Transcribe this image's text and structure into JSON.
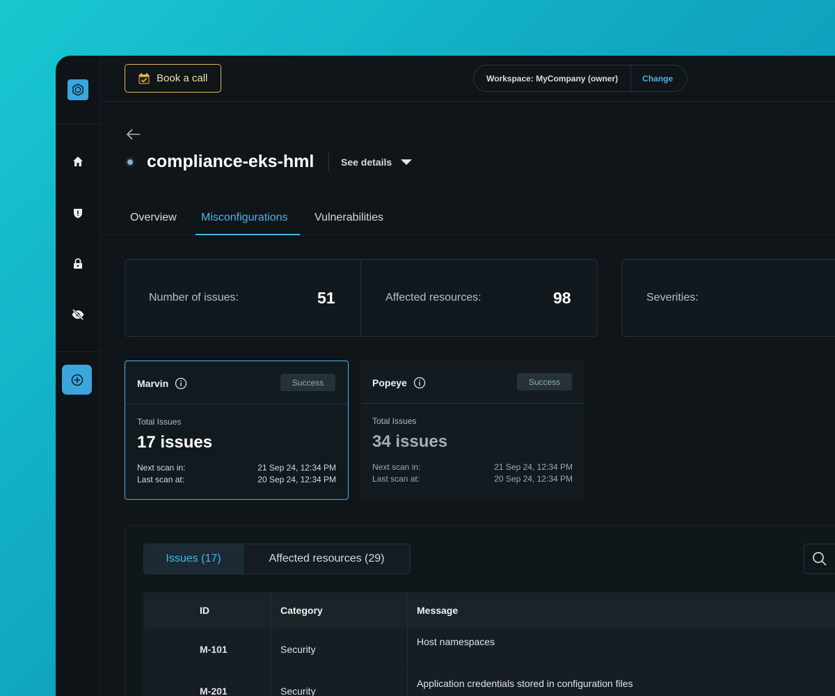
{
  "topbar": {
    "book_call_label": "Book a call",
    "workspace_label": "Workspace: MyCompany (owner)",
    "workspace_change": "Change"
  },
  "header": {
    "title": "compliance-eks-hml",
    "see_details": "See details"
  },
  "tabs": [
    {
      "label": "Overview",
      "active": false
    },
    {
      "label": "Misconfigurations",
      "active": true
    },
    {
      "label": "Vulnerabilities",
      "active": false
    }
  ],
  "stats": {
    "issues_label": "Number of issues:",
    "issues_value": "51",
    "resources_label": "Affected resources:",
    "resources_value": "98",
    "severities_label": "Severities:"
  },
  "scanners": [
    {
      "name": "Marvin",
      "status": "Success",
      "total_label": "Total Issues",
      "total_value": "17 issues",
      "next_label": "Next scan in:",
      "next_value": "21 Sep 24, 12:34 PM",
      "last_label": "Last scan at:",
      "last_value": "20 Sep 24, 12:34 PM"
    },
    {
      "name": "Popeye",
      "status": "Success",
      "total_label": "Total Issues",
      "total_value": "34 issues",
      "next_label": "Next scan in:",
      "next_value": "21 Sep 24, 12:34 PM",
      "last_label": "Last scan at:",
      "last_value": "20 Sep 24, 12:34 PM"
    }
  ],
  "issues_table": {
    "tab_issues": "Issues (17)",
    "tab_resources": "Affected resources (29)",
    "columns": [
      "ID",
      "Category",
      "Message"
    ],
    "rows": [
      {
        "id": "M-101",
        "category": "Security",
        "message": "Host namespaces"
      },
      {
        "id": "M-201",
        "category": "Security",
        "message": "Application credentials stored in configuration files"
      }
    ]
  },
  "colors": {
    "accent": "#4fb3e6",
    "background": "#0f1519",
    "book_call_border": "#d9b95a"
  },
  "icons": [
    "logo-icon",
    "home-icon",
    "shield-alert-icon",
    "lock-icon",
    "eye-off-icon",
    "plus-circle-icon",
    "calendar-check-icon",
    "arrow-left-icon",
    "caret-down-icon",
    "info-icon",
    "search-icon"
  ]
}
